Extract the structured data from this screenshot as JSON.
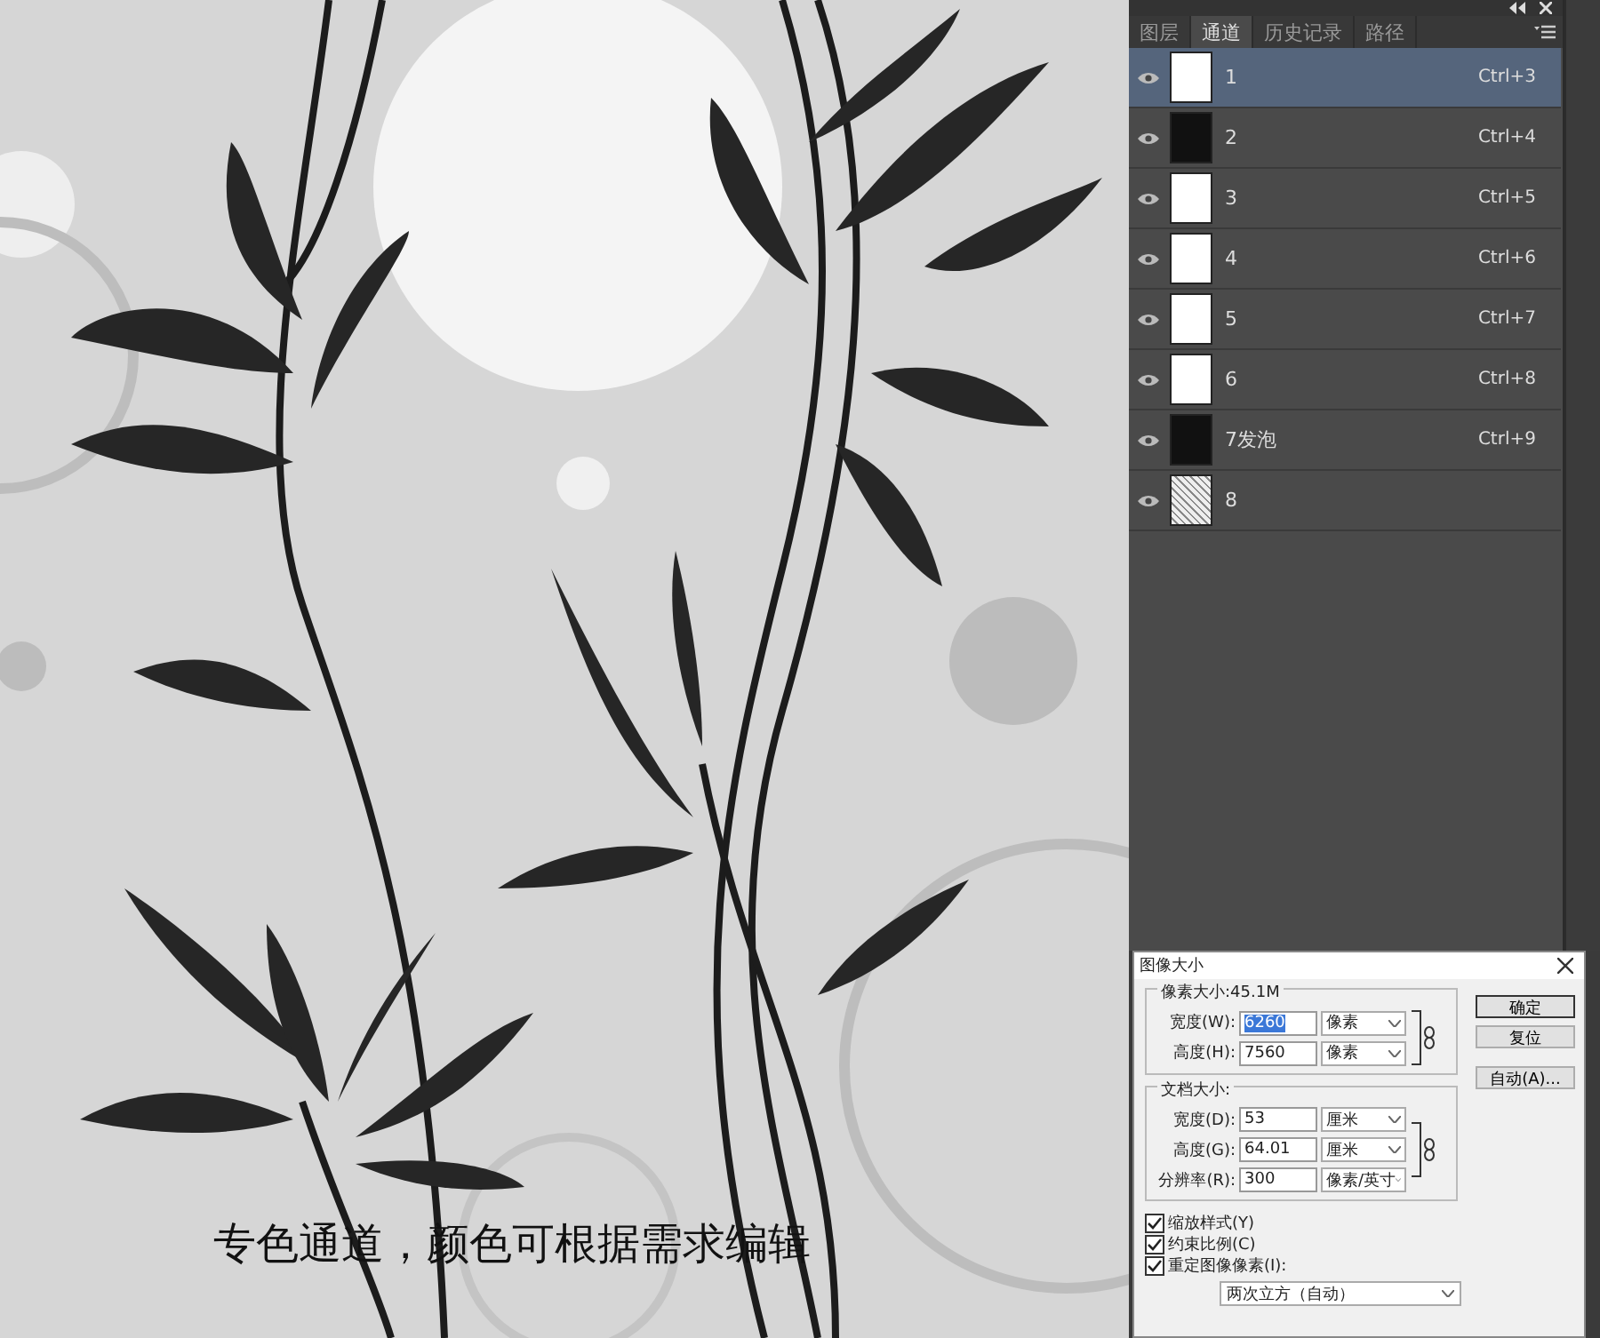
{
  "artwork": {
    "caption": "专色通道，颜色可根据需求编辑"
  },
  "channels_panel": {
    "tabs": [
      {
        "label": "图层",
        "selected": false
      },
      {
        "label": "通道",
        "selected": true
      },
      {
        "label": "历史记录",
        "selected": false
      },
      {
        "label": "路径",
        "selected": false
      }
    ],
    "channels": [
      {
        "name": "1",
        "shortcut": "Ctrl+3",
        "visible": true,
        "selected": true,
        "kind": "light"
      },
      {
        "name": "2",
        "shortcut": "Ctrl+4",
        "visible": true,
        "selected": false,
        "kind": "dark"
      },
      {
        "name": "3",
        "shortcut": "Ctrl+5",
        "visible": true,
        "selected": false,
        "kind": "light"
      },
      {
        "name": "4",
        "shortcut": "Ctrl+6",
        "visible": true,
        "selected": false,
        "kind": "light"
      },
      {
        "name": "5",
        "shortcut": "Ctrl+7",
        "visible": true,
        "selected": false,
        "kind": "light"
      },
      {
        "name": "6",
        "shortcut": "Ctrl+8",
        "visible": true,
        "selected": false,
        "kind": "light"
      },
      {
        "name": "7发泡",
        "shortcut": "Ctrl+9",
        "visible": true,
        "selected": false,
        "kind": "dark"
      },
      {
        "name": "8",
        "visible": true,
        "selected": false,
        "kind": "speckled"
      }
    ]
  },
  "dialog": {
    "title": "图像大小",
    "pixel_group": {
      "title": "像素大小:45.1M",
      "fields": [
        {
          "label": "宽度(W):",
          "value": "6260",
          "unit": "像素",
          "selected": true
        },
        {
          "label": "高度(H):",
          "value": "7560",
          "unit": "像素",
          "selected": false
        }
      ]
    },
    "document_group": {
      "title": "文档大小:",
      "fields": [
        {
          "label": "宽度(D):",
          "value": "53",
          "unit": "厘米",
          "selected": false
        },
        {
          "label": "高度(G):",
          "value": "64.01",
          "unit": "厘米",
          "selected": false
        },
        {
          "label": "分辨率(R):",
          "value": "300",
          "unit": "像素/英寸",
          "selected": false
        }
      ]
    },
    "checkboxes": [
      {
        "label": "缩放样式(Y)",
        "checked": true
      },
      {
        "label": "约束比例(C)",
        "checked": true
      },
      {
        "label": "重定图像像素(I):",
        "checked": true
      }
    ],
    "resample": "两次立方（自动）",
    "buttons": [
      {
        "label": "确定",
        "default": true
      },
      {
        "label": "复位",
        "default": false
      },
      {
        "label": "自动(A)...",
        "default": false
      }
    ]
  }
}
